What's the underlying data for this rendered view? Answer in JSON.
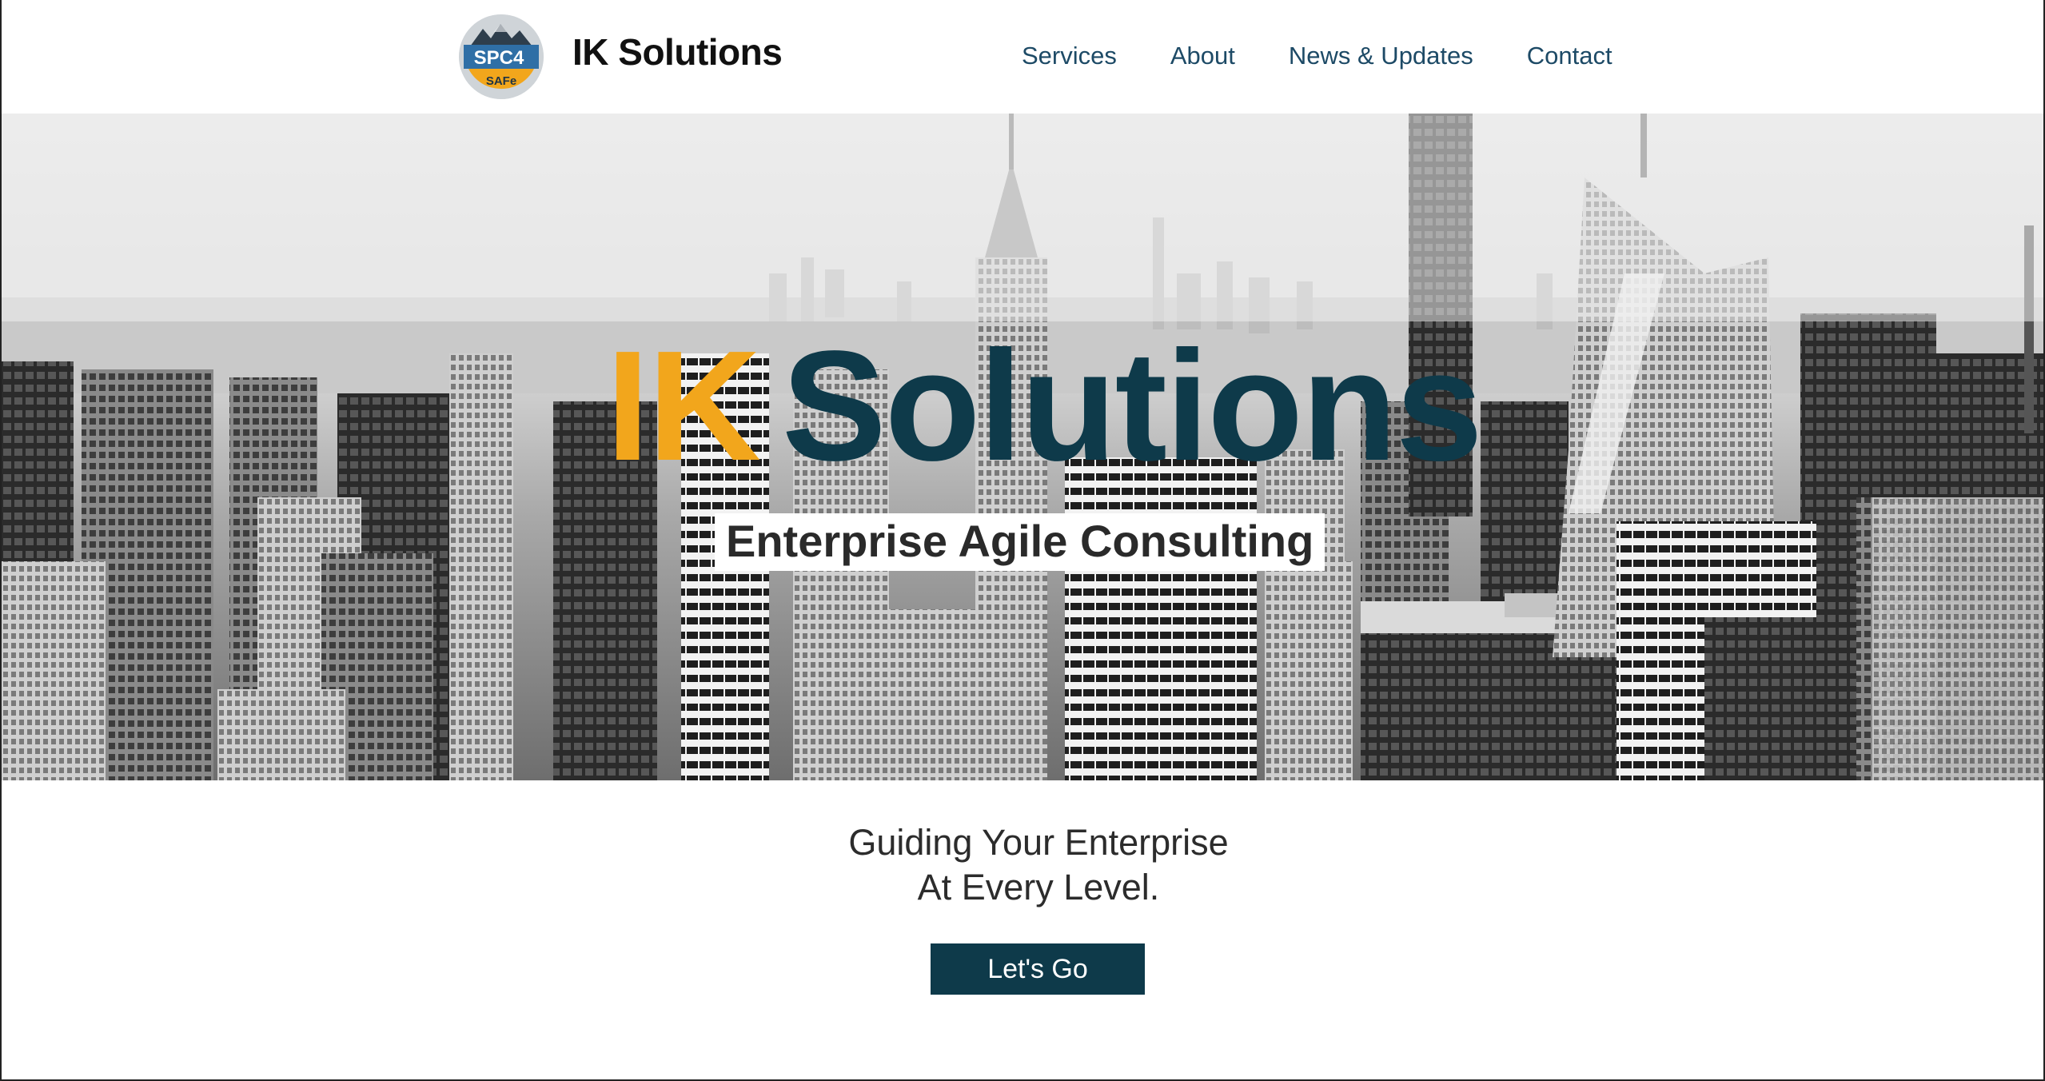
{
  "header": {
    "logo": {
      "line1": "SPC4",
      "line2": "SAFe",
      "icon": "spc4-safe-badge-icon"
    },
    "brand": "IK Solutions",
    "nav": [
      {
        "label": "Services"
      },
      {
        "label": "About"
      },
      {
        "label": "News & Updates"
      },
      {
        "label": "Contact"
      }
    ]
  },
  "hero": {
    "title_part1": "IK",
    "title_part2": "Solutions",
    "subtitle": "Enterprise Agile Consulting",
    "background": "city-skyline-image"
  },
  "tagline": {
    "line1": "Guiding Your Enterprise",
    "line2": "At Every Level."
  },
  "cta": {
    "label": "Let's Go"
  },
  "colors": {
    "accent_orange": "#f2a61c",
    "brand_dark": "#0e3a4a",
    "nav_text": "#1d4a66"
  }
}
